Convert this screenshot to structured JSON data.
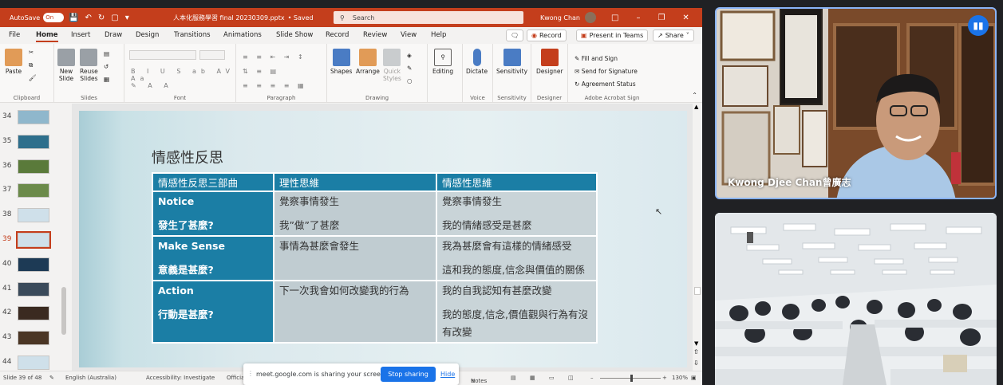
{
  "ppt": {
    "titlebar": {
      "autosave_label": "AutoSave",
      "autosave_state": "On",
      "doc_title": "人本化服務學習 final 20230309.pptx",
      "saved": "• Saved",
      "search_placeholder": "Search",
      "user_name": "Kwong Chan"
    },
    "menu": {
      "tabs": [
        "File",
        "Home",
        "Insert",
        "Draw",
        "Design",
        "Transitions",
        "Animations",
        "Slide Show",
        "Record",
        "Review",
        "View",
        "Help"
      ],
      "active_tab": "Home",
      "record_label": "Record",
      "present_label": "Present in Teams",
      "share_label": "Share"
    },
    "ribbon": {
      "groups": {
        "clipboard": "Clipboard",
        "slides": "Slides",
        "font": "Font",
        "paragraph": "Paragraph",
        "drawing": "Drawing",
        "voice": "Voice",
        "sensitivity": "Sensitivity",
        "designer": "Designer",
        "acrobat": "Adobe Acrobat Sign"
      },
      "buttons": {
        "paste": "Paste",
        "new_slide_1": "New",
        "new_slide_2": "Slide",
        "reuse_1": "Reuse",
        "reuse_2": "Slides",
        "shapes": "Shapes",
        "arrange": "Arrange",
        "quick_styles_1": "Quick",
        "quick_styles_2": "Styles",
        "editing": "Editing",
        "dictate": "Dictate",
        "sensitivity": "Sensitivity",
        "designer": "Designer",
        "fill_sign": "Fill and Sign",
        "send_signature": "Send for Signature",
        "agreement_status": "Agreement Status"
      }
    },
    "thumbnails": {
      "numbers": [
        "34",
        "35",
        "36",
        "37",
        "38",
        "39",
        "40",
        "41",
        "42",
        "43",
        "44"
      ],
      "selected": "39",
      "colors": [
        "#8fb7cc",
        "#2e6f8c",
        "#5a7a3a",
        "#6b8a4a",
        "#cfe0ea",
        "#cfe0ea",
        "#1d3a55",
        "#3a4a5a",
        "#3a2a20",
        "#4a3524",
        "#cfe0ea"
      ]
    },
    "slide": {
      "title": "情感性反思",
      "headers": [
        "情感性反思三部曲",
        "理性思維",
        "情感性思維"
      ],
      "rows": [
        {
          "c1": [
            "Notice",
            "發生了甚麼?"
          ],
          "c2": [
            "覺察事情發生",
            "我”做”了甚麼"
          ],
          "c3": [
            "覺察事情發生",
            "我的情緒感受是甚麼"
          ]
        },
        {
          "c1": [
            "Make Sense",
            "意義是甚麼?"
          ],
          "c2": [
            "事情為甚麼會發生"
          ],
          "c3": [
            "我為甚麼會有這樣的情緒感受",
            "這和我的態度,信念與價值的關係"
          ]
        },
        {
          "c1": [
            "Action",
            "行動是甚麼?"
          ],
          "c2": [
            "下一次我會如何改變我的行為"
          ],
          "c3": [
            "我的自我認知有甚麼改變",
            "我的態度,信念,價值觀與行為有沒有改變"
          ]
        }
      ]
    },
    "status": {
      "slide_count": "Slide 39 of 48",
      "language": "English (Australia)",
      "accessibility": "Accessibility: Investigate",
      "label_info": "Official - Internal (External Sharing)",
      "notes": "Notes",
      "zoom": "130%"
    },
    "share_bar": {
      "message": "meet.google.com is sharing your screen.",
      "stop": "Stop sharing",
      "hide": "Hide"
    }
  },
  "meet": {
    "speaker_name": "Kwong Djee Chan曾廣志",
    "speaking_icon": "audio-wave-icon"
  },
  "colors": {
    "ppt_accent": "#c43e1c",
    "table_header": "#1b7ea5",
    "meet_blue": "#1a73e8"
  }
}
